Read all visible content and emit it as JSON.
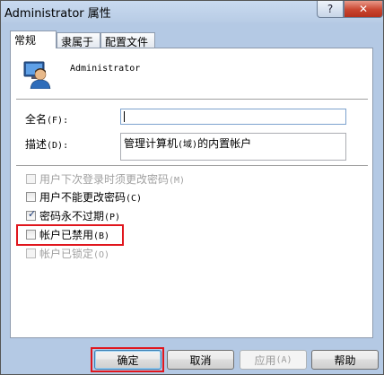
{
  "window": {
    "title": "Administrator 属性",
    "help_label": "?",
    "close_label": "✕"
  },
  "tabs": [
    {
      "label": "常规",
      "active": true
    },
    {
      "label": "隶属于",
      "active": false
    },
    {
      "label": "配置文件",
      "active": false
    }
  ],
  "user": {
    "name": "Administrator",
    "icon": "user-icon"
  },
  "fields": {
    "fullname_label": "全名",
    "fullname_key": "(F):",
    "fullname_value": "",
    "description_label": "描述",
    "description_key": "(D):",
    "description_value_a": "管理计算机",
    "description_value_b": "(域)",
    "description_value_c": "的内置帐户"
  },
  "checkboxes": [
    {
      "label": "用户下次登录时须更改密码",
      "key": "(M)",
      "checked": false,
      "enabled": false
    },
    {
      "label": "用户不能更改密码",
      "key": "(C)",
      "checked": false,
      "enabled": true
    },
    {
      "label": "密码永不过期",
      "key": "(P)",
      "checked": true,
      "enabled": true
    },
    {
      "label": "帐户已禁用",
      "key": "(B)",
      "checked": false,
      "enabled": true
    },
    {
      "label": "帐户已锁定",
      "key": "(O)",
      "checked": false,
      "enabled": false
    }
  ],
  "buttons": {
    "ok": "确定",
    "cancel": "取消",
    "apply": "应用",
    "apply_key": "(A)",
    "help": "帮助"
  },
  "colors": {
    "highlight_box": "#e0161d",
    "check_mark": "#1f3d7a"
  }
}
